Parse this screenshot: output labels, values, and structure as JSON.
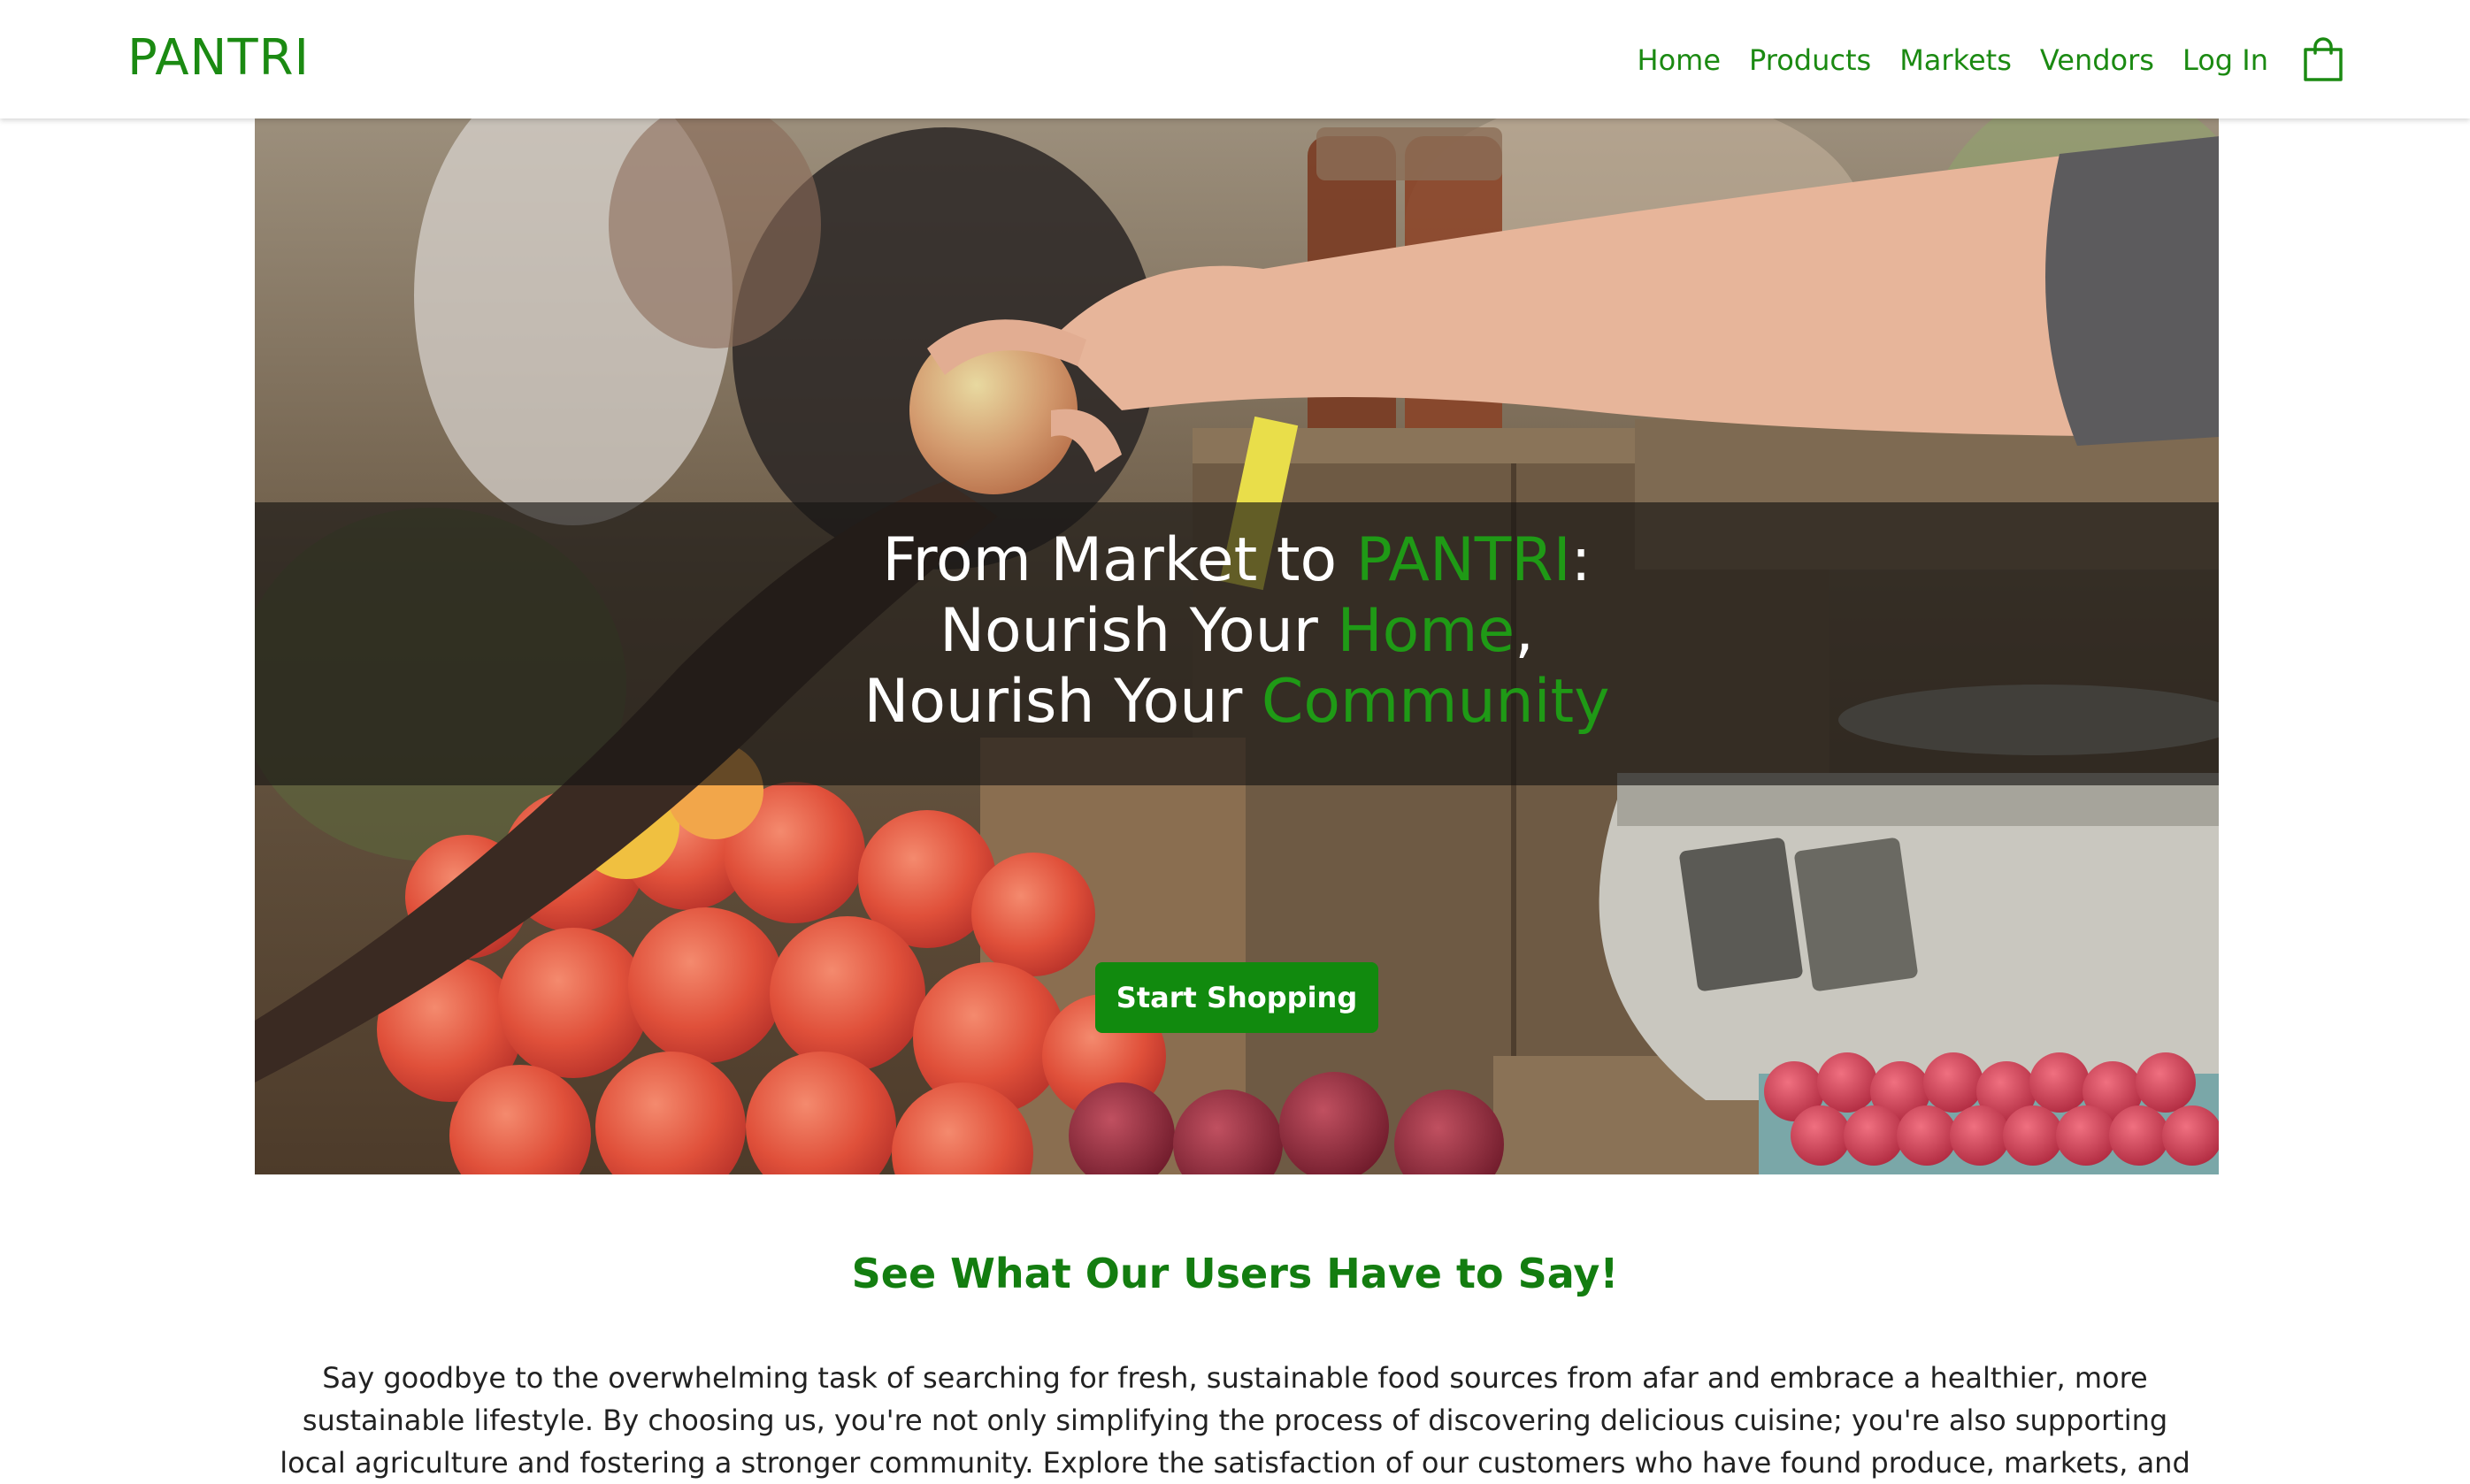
{
  "brand": "PANTRI",
  "nav": {
    "home": "Home",
    "products": "Products",
    "markets": "Markets",
    "vendors": "Vendors",
    "login": "Log In",
    "cart_icon": "shopping-bag-icon"
  },
  "hero": {
    "line1_before": "From Market to ",
    "line1_accent": "PANTRI",
    "line1_after": ":",
    "line2_before": "Nourish Your ",
    "line2_accent": "Home",
    "line2_after": ",",
    "line3_before": "Nourish Your ",
    "line3_accent": "Community",
    "cta_label": "Start Shopping"
  },
  "testimonials": {
    "title": "See What Our Users Have to Say!",
    "intro": "Say goodbye to the overwhelming task of searching for fresh, sustainable food sources from afar and embrace a healthier, more sustainable lifestyle. By choosing us, you're not only simplifying the process of discovering delicious cuisine; you're also supporting local agriculture and fostering a stronger community. Explore the satisfaction of our customers who have found produce, markets, and"
  },
  "colors": {
    "brand_green": "#1b8a12",
    "button_green": "#118a0e",
    "accent_green": "#1f9a16",
    "band_overlay": "rgba(22,20,18,0.64)"
  }
}
